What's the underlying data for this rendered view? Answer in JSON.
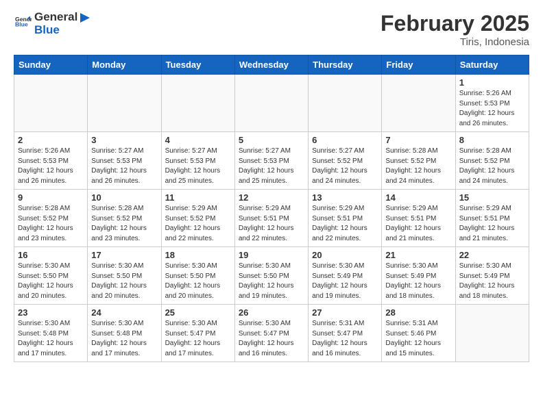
{
  "header": {
    "logo_general": "General",
    "logo_blue": "Blue",
    "month_title": "February 2025",
    "location": "Tiris, Indonesia"
  },
  "days_of_week": [
    "Sunday",
    "Monday",
    "Tuesday",
    "Wednesday",
    "Thursday",
    "Friday",
    "Saturday"
  ],
  "weeks": [
    [
      {
        "day": "",
        "info": ""
      },
      {
        "day": "",
        "info": ""
      },
      {
        "day": "",
        "info": ""
      },
      {
        "day": "",
        "info": ""
      },
      {
        "day": "",
        "info": ""
      },
      {
        "day": "",
        "info": ""
      },
      {
        "day": "1",
        "info": "Sunrise: 5:26 AM\nSunset: 5:53 PM\nDaylight: 12 hours\nand 26 minutes."
      }
    ],
    [
      {
        "day": "2",
        "info": "Sunrise: 5:26 AM\nSunset: 5:53 PM\nDaylight: 12 hours\nand 26 minutes."
      },
      {
        "day": "3",
        "info": "Sunrise: 5:27 AM\nSunset: 5:53 PM\nDaylight: 12 hours\nand 26 minutes."
      },
      {
        "day": "4",
        "info": "Sunrise: 5:27 AM\nSunset: 5:53 PM\nDaylight: 12 hours\nand 25 minutes."
      },
      {
        "day": "5",
        "info": "Sunrise: 5:27 AM\nSunset: 5:53 PM\nDaylight: 12 hours\nand 25 minutes."
      },
      {
        "day": "6",
        "info": "Sunrise: 5:27 AM\nSunset: 5:52 PM\nDaylight: 12 hours\nand 24 minutes."
      },
      {
        "day": "7",
        "info": "Sunrise: 5:28 AM\nSunset: 5:52 PM\nDaylight: 12 hours\nand 24 minutes."
      },
      {
        "day": "8",
        "info": "Sunrise: 5:28 AM\nSunset: 5:52 PM\nDaylight: 12 hours\nand 24 minutes."
      }
    ],
    [
      {
        "day": "9",
        "info": "Sunrise: 5:28 AM\nSunset: 5:52 PM\nDaylight: 12 hours\nand 23 minutes."
      },
      {
        "day": "10",
        "info": "Sunrise: 5:28 AM\nSunset: 5:52 PM\nDaylight: 12 hours\nand 23 minutes."
      },
      {
        "day": "11",
        "info": "Sunrise: 5:29 AM\nSunset: 5:52 PM\nDaylight: 12 hours\nand 22 minutes."
      },
      {
        "day": "12",
        "info": "Sunrise: 5:29 AM\nSunset: 5:51 PM\nDaylight: 12 hours\nand 22 minutes."
      },
      {
        "day": "13",
        "info": "Sunrise: 5:29 AM\nSunset: 5:51 PM\nDaylight: 12 hours\nand 22 minutes."
      },
      {
        "day": "14",
        "info": "Sunrise: 5:29 AM\nSunset: 5:51 PM\nDaylight: 12 hours\nand 21 minutes."
      },
      {
        "day": "15",
        "info": "Sunrise: 5:29 AM\nSunset: 5:51 PM\nDaylight: 12 hours\nand 21 minutes."
      }
    ],
    [
      {
        "day": "16",
        "info": "Sunrise: 5:30 AM\nSunset: 5:50 PM\nDaylight: 12 hours\nand 20 minutes."
      },
      {
        "day": "17",
        "info": "Sunrise: 5:30 AM\nSunset: 5:50 PM\nDaylight: 12 hours\nand 20 minutes."
      },
      {
        "day": "18",
        "info": "Sunrise: 5:30 AM\nSunset: 5:50 PM\nDaylight: 12 hours\nand 20 minutes."
      },
      {
        "day": "19",
        "info": "Sunrise: 5:30 AM\nSunset: 5:50 PM\nDaylight: 12 hours\nand 19 minutes."
      },
      {
        "day": "20",
        "info": "Sunrise: 5:30 AM\nSunset: 5:49 PM\nDaylight: 12 hours\nand 19 minutes."
      },
      {
        "day": "21",
        "info": "Sunrise: 5:30 AM\nSunset: 5:49 PM\nDaylight: 12 hours\nand 18 minutes."
      },
      {
        "day": "22",
        "info": "Sunrise: 5:30 AM\nSunset: 5:49 PM\nDaylight: 12 hours\nand 18 minutes."
      }
    ],
    [
      {
        "day": "23",
        "info": "Sunrise: 5:30 AM\nSunset: 5:48 PM\nDaylight: 12 hours\nand 17 minutes."
      },
      {
        "day": "24",
        "info": "Sunrise: 5:30 AM\nSunset: 5:48 PM\nDaylight: 12 hours\nand 17 minutes."
      },
      {
        "day": "25",
        "info": "Sunrise: 5:30 AM\nSunset: 5:47 PM\nDaylight: 12 hours\nand 17 minutes."
      },
      {
        "day": "26",
        "info": "Sunrise: 5:30 AM\nSunset: 5:47 PM\nDaylight: 12 hours\nand 16 minutes."
      },
      {
        "day": "27",
        "info": "Sunrise: 5:31 AM\nSunset: 5:47 PM\nDaylight: 12 hours\nand 16 minutes."
      },
      {
        "day": "28",
        "info": "Sunrise: 5:31 AM\nSunset: 5:46 PM\nDaylight: 12 hours\nand 15 minutes."
      },
      {
        "day": "",
        "info": ""
      }
    ]
  ]
}
